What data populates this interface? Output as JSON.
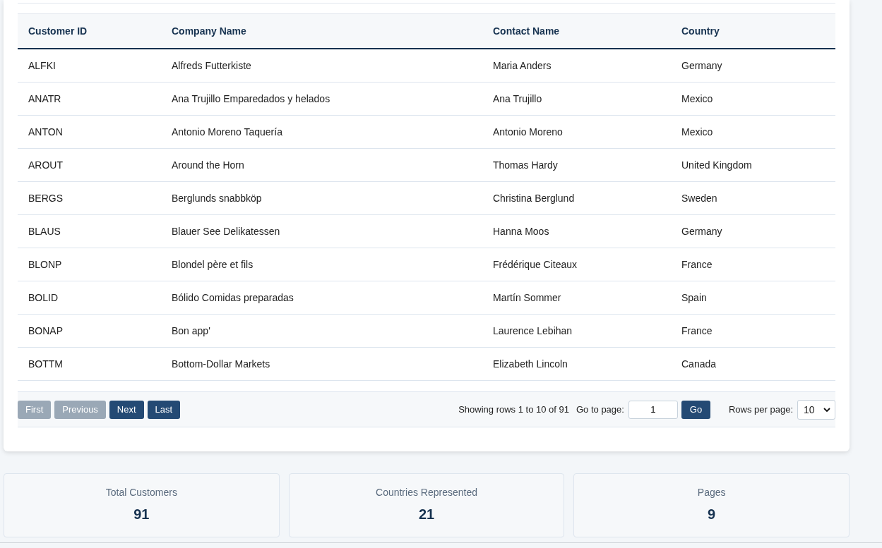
{
  "table": {
    "columns": [
      "Customer ID",
      "Company Name",
      "Contact Name",
      "Country"
    ],
    "rows": [
      [
        "ALFKI",
        "Alfreds Futterkiste",
        "Maria Anders",
        "Germany"
      ],
      [
        "ANATR",
        "Ana Trujillo Emparedados y helados",
        "Ana Trujillo",
        "Mexico"
      ],
      [
        "ANTON",
        "Antonio Moreno Taquería",
        "Antonio Moreno",
        "Mexico"
      ],
      [
        "AROUT",
        "Around the Horn",
        "Thomas Hardy",
        "United Kingdom"
      ],
      [
        "BERGS",
        "Berglunds snabbköp",
        "Christina Berglund",
        "Sweden"
      ],
      [
        "BLAUS",
        "Blauer See Delikatessen",
        "Hanna Moos",
        "Germany"
      ],
      [
        "BLONP",
        "Blondel père et fils",
        "Frédérique Citeaux",
        "France"
      ],
      [
        "BOLID",
        "Bólido Comidas preparadas",
        "Martín Sommer",
        "Spain"
      ],
      [
        "BONAP",
        "Bon app'",
        "Laurence Lebihan",
        "France"
      ],
      [
        "BOTTM",
        "Bottom-Dollar Markets",
        "Elizabeth Lincoln",
        "Canada"
      ]
    ]
  },
  "pagination": {
    "buttons": [
      {
        "label": "First",
        "disabled": true
      },
      {
        "label": "Previous",
        "disabled": true
      },
      {
        "label": "Next",
        "disabled": false
      },
      {
        "label": "Last",
        "disabled": false
      }
    ],
    "summary": "Showing rows 1 to 10 of 91",
    "goto_label": "Go to page:",
    "goto_value": "1",
    "go_button": "Go",
    "rows_per_page_label": "Rows per page:",
    "rows_per_page_value": "10"
  },
  "stats": [
    {
      "label": "Total Customers",
      "value": "91"
    },
    {
      "label": "Countries Represented",
      "value": "21"
    },
    {
      "label": "Pages",
      "value": "9"
    }
  ]
}
